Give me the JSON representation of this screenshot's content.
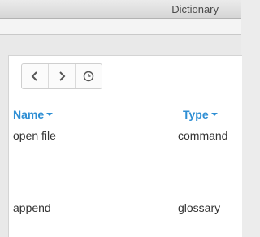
{
  "window": {
    "title": "Dictionary"
  },
  "navigation": {
    "back_icon": "chevron-left-icon",
    "forward_icon": "chevron-right-icon",
    "history_icon": "clock-icon"
  },
  "table": {
    "columns": [
      {
        "label": "Name",
        "sort_icon": "caret-down-icon"
      },
      {
        "label": "Type",
        "sort_icon": "caret-down-icon"
      }
    ],
    "rows": [
      {
        "name": "open file",
        "type": "command"
      },
      {
        "name": "append",
        "type": "glossary"
      }
    ]
  },
  "colors": {
    "header_accent": "#2f8fd4",
    "text": "#333333"
  }
}
